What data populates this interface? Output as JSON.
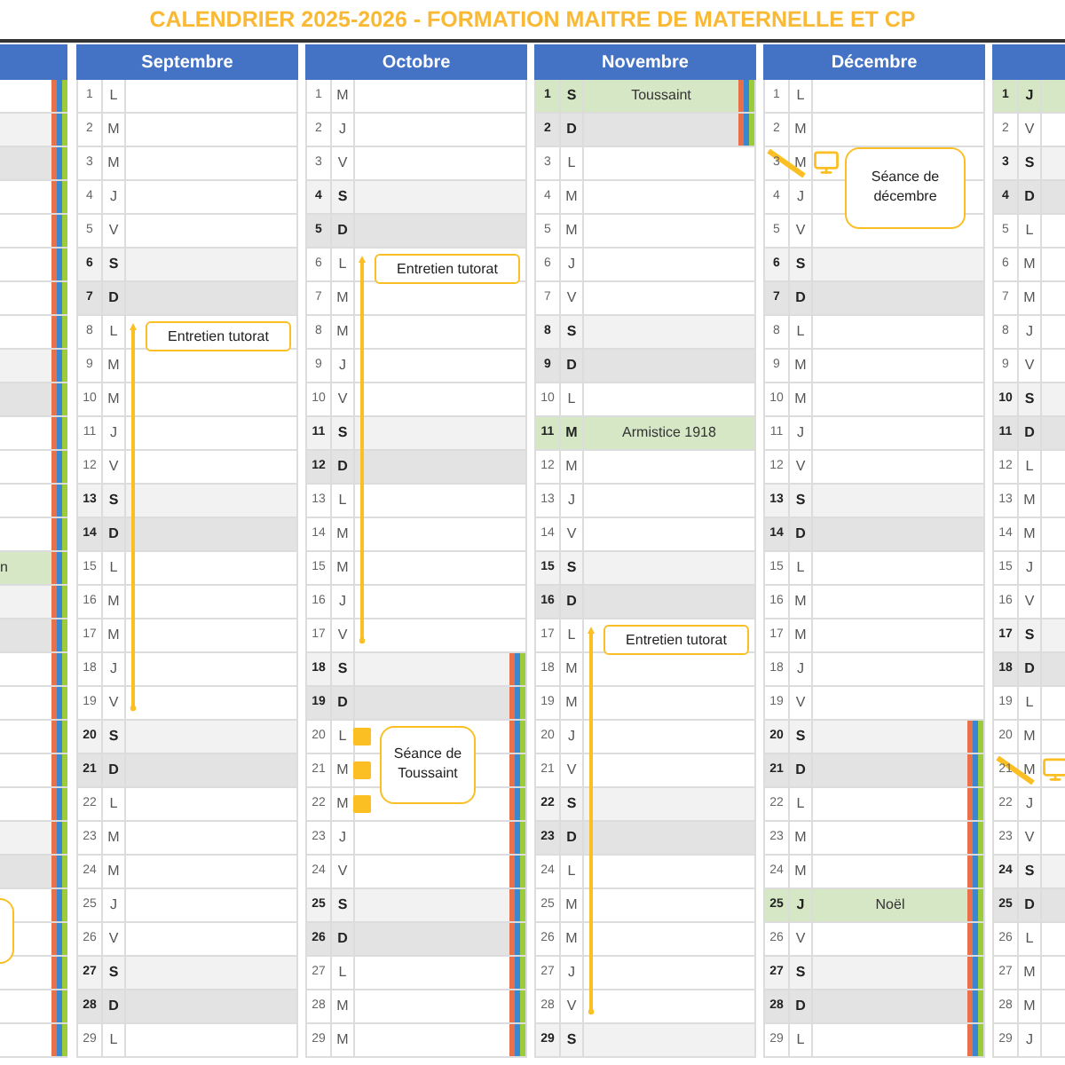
{
  "title": "CALENDRIER 2025-2026 - FORMATION MAITRE DE MATERNELLE ET CP",
  "months": [
    {
      "kind": "cut_left",
      "days": [
        {
          "kind": "wd",
          "vacation": true
        },
        {
          "kind": "sat",
          "vacation": true
        },
        {
          "kind": "sun",
          "vacation": true
        },
        {
          "kind": "wd",
          "vacation": true
        },
        {
          "kind": "wd",
          "vacation": true
        },
        {
          "kind": "wd",
          "vacation": true
        },
        {
          "kind": "wd",
          "vacation": true
        },
        {
          "kind": "wd",
          "vacation": true
        },
        {
          "kind": "sat",
          "vacation": true
        },
        {
          "kind": "sun",
          "vacation": true
        },
        {
          "kind": "wd",
          "vacation": true
        },
        {
          "kind": "wd",
          "vacation": true
        },
        {
          "kind": "wd",
          "vacation": true
        },
        {
          "kind": "wd",
          "vacation": true
        },
        {
          "kind": "hol",
          "label": "n",
          "vacation": true
        },
        {
          "kind": "sat",
          "vacation": true
        },
        {
          "kind": "sun",
          "vacation": true
        },
        {
          "kind": "wd",
          "vacation": true
        },
        {
          "kind": "wd",
          "vacation": true
        },
        {
          "kind": "wd",
          "vacation": true
        },
        {
          "kind": "wd",
          "vacation": true
        },
        {
          "kind": "wd",
          "vacation": true
        },
        {
          "kind": "sat",
          "vacation": true
        },
        {
          "kind": "sun",
          "vacation": true
        },
        {
          "kind": "wd",
          "vacation": true,
          "cut_callout": true
        },
        {
          "kind": "wd",
          "vacation": true
        },
        {
          "kind": "wd",
          "vacation": true
        },
        {
          "kind": "wd",
          "vacation": true
        },
        {
          "kind": "wd",
          "vacation": true
        }
      ]
    },
    {
      "kind": "full",
      "name": "Septembre",
      "days": [
        {
          "n": "1",
          "w": "L",
          "kind": "wd",
          "vacation": false
        },
        {
          "n": "2",
          "w": "M",
          "kind": "wd",
          "vacation": false
        },
        {
          "n": "3",
          "w": "M",
          "kind": "wd",
          "vacation": false
        },
        {
          "n": "4",
          "w": "J",
          "kind": "wd",
          "vacation": false
        },
        {
          "n": "5",
          "w": "V",
          "kind": "wd",
          "vacation": false
        },
        {
          "n": "6",
          "w": "S",
          "kind": "sat",
          "vacation": false
        },
        {
          "n": "7",
          "w": "D",
          "kind": "sun",
          "vacation": false
        },
        {
          "n": "8",
          "w": "L",
          "kind": "wd",
          "vacation": false,
          "note": "Entretien tutorat"
        },
        {
          "n": "9",
          "w": "M",
          "kind": "wd",
          "vacation": false
        },
        {
          "n": "10",
          "w": "M",
          "kind": "wd",
          "vacation": false
        },
        {
          "n": "11",
          "w": "J",
          "kind": "wd",
          "vacation": false
        },
        {
          "n": "12",
          "w": "V",
          "kind": "wd",
          "vacation": false
        },
        {
          "n": "13",
          "w": "S",
          "kind": "sat",
          "vacation": false
        },
        {
          "n": "14",
          "w": "D",
          "kind": "sun",
          "vacation": false
        },
        {
          "n": "15",
          "w": "L",
          "kind": "wd",
          "vacation": false
        },
        {
          "n": "16",
          "w": "M",
          "kind": "wd",
          "vacation": false
        },
        {
          "n": "17",
          "w": "M",
          "kind": "wd",
          "vacation": false
        },
        {
          "n": "18",
          "w": "J",
          "kind": "wd",
          "vacation": false
        },
        {
          "n": "19",
          "w": "V",
          "kind": "wd",
          "vacation": false,
          "arrow_end": true
        },
        {
          "n": "20",
          "w": "S",
          "kind": "sat",
          "vacation": false
        },
        {
          "n": "21",
          "w": "D",
          "kind": "sun",
          "vacation": false
        },
        {
          "n": "22",
          "w": "L",
          "kind": "wd",
          "vacation": false
        },
        {
          "n": "23",
          "w": "M",
          "kind": "wd",
          "vacation": false
        },
        {
          "n": "24",
          "w": "M",
          "kind": "wd",
          "vacation": false
        },
        {
          "n": "25",
          "w": "J",
          "kind": "wd",
          "vacation": false
        },
        {
          "n": "26",
          "w": "V",
          "kind": "wd",
          "vacation": false
        },
        {
          "n": "27",
          "w": "S",
          "kind": "sat",
          "vacation": false
        },
        {
          "n": "28",
          "w": "D",
          "kind": "sun",
          "vacation": false
        },
        {
          "n": "29",
          "w": "L",
          "kind": "wd",
          "vacation": false
        }
      ]
    },
    {
      "kind": "full",
      "name": "Octobre",
      "days": [
        {
          "n": "1",
          "w": "M",
          "kind": "wd",
          "vacation": false
        },
        {
          "n": "2",
          "w": "J",
          "kind": "wd",
          "vacation": false
        },
        {
          "n": "3",
          "w": "V",
          "kind": "wd",
          "vacation": false
        },
        {
          "n": "4",
          "w": "S",
          "kind": "sat",
          "vacation": false
        },
        {
          "n": "5",
          "w": "D",
          "kind": "sun",
          "vacation": false
        },
        {
          "n": "6",
          "w": "L",
          "kind": "wd",
          "vacation": false,
          "note": "Entretien tutorat"
        },
        {
          "n": "7",
          "w": "M",
          "kind": "wd",
          "vacation": false
        },
        {
          "n": "8",
          "w": "M",
          "kind": "wd",
          "vacation": false
        },
        {
          "n": "9",
          "w": "J",
          "kind": "wd",
          "vacation": false
        },
        {
          "n": "10",
          "w": "V",
          "kind": "wd",
          "vacation": false
        },
        {
          "n": "11",
          "w": "S",
          "kind": "sat",
          "vacation": false
        },
        {
          "n": "12",
          "w": "D",
          "kind": "sun",
          "vacation": false
        },
        {
          "n": "13",
          "w": "L",
          "kind": "wd",
          "vacation": false
        },
        {
          "n": "14",
          "w": "M",
          "kind": "wd",
          "vacation": false
        },
        {
          "n": "15",
          "w": "M",
          "kind": "wd",
          "vacation": false
        },
        {
          "n": "16",
          "w": "J",
          "kind": "wd",
          "vacation": false
        },
        {
          "n": "17",
          "w": "V",
          "kind": "wd",
          "vacation": false,
          "arrow_end": true
        },
        {
          "n": "18",
          "w": "S",
          "kind": "sat",
          "vacation": true
        },
        {
          "n": "19",
          "w": "D",
          "kind": "sun",
          "vacation": true
        },
        {
          "n": "20",
          "w": "L",
          "kind": "wd",
          "vacation": true,
          "marker": true,
          "callout": "Séance de Toussaint"
        },
        {
          "n": "21",
          "w": "M",
          "kind": "wd",
          "vacation": true,
          "marker": true
        },
        {
          "n": "22",
          "w": "M",
          "kind": "wd",
          "vacation": true,
          "marker": true
        },
        {
          "n": "23",
          "w": "J",
          "kind": "wd",
          "vacation": true
        },
        {
          "n": "24",
          "w": "V",
          "kind": "wd",
          "vacation": true
        },
        {
          "n": "25",
          "w": "S",
          "kind": "sat",
          "vacation": true
        },
        {
          "n": "26",
          "w": "D",
          "kind": "sun",
          "vacation": true
        },
        {
          "n": "27",
          "w": "L",
          "kind": "wd",
          "vacation": true
        },
        {
          "n": "28",
          "w": "M",
          "kind": "wd",
          "vacation": true
        },
        {
          "n": "29",
          "w": "M",
          "kind": "wd",
          "vacation": true
        }
      ]
    },
    {
      "kind": "full",
      "name": "Novembre",
      "days": [
        {
          "n": "1",
          "w": "S",
          "kind": "hol",
          "label": "Toussaint",
          "vacation": true
        },
        {
          "n": "2",
          "w": "D",
          "kind": "sun",
          "vacation": true
        },
        {
          "n": "3",
          "w": "L",
          "kind": "wd",
          "vacation": false
        },
        {
          "n": "4",
          "w": "M",
          "kind": "wd",
          "vacation": false
        },
        {
          "n": "5",
          "w": "M",
          "kind": "wd",
          "vacation": false
        },
        {
          "n": "6",
          "w": "J",
          "kind": "wd",
          "vacation": false
        },
        {
          "n": "7",
          "w": "V",
          "kind": "wd",
          "vacation": false
        },
        {
          "n": "8",
          "w": "S",
          "kind": "sat",
          "vacation": false
        },
        {
          "n": "9",
          "w": "D",
          "kind": "sun",
          "vacation": false
        },
        {
          "n": "10",
          "w": "L",
          "kind": "wd",
          "vacation": false
        },
        {
          "n": "11",
          "w": "M",
          "kind": "hol",
          "label": "Armistice 1918",
          "vacation": false
        },
        {
          "n": "12",
          "w": "M",
          "kind": "wd",
          "vacation": false
        },
        {
          "n": "13",
          "w": "J",
          "kind": "wd",
          "vacation": false
        },
        {
          "n": "14",
          "w": "V",
          "kind": "wd",
          "vacation": false
        },
        {
          "n": "15",
          "w": "S",
          "kind": "sat",
          "vacation": false
        },
        {
          "n": "16",
          "w": "D",
          "kind": "sun",
          "vacation": false
        },
        {
          "n": "17",
          "w": "L",
          "kind": "wd",
          "vacation": false,
          "note": "Entretien tutorat"
        },
        {
          "n": "18",
          "w": "M",
          "kind": "wd",
          "vacation": false
        },
        {
          "n": "19",
          "w": "M",
          "kind": "wd",
          "vacation": false
        },
        {
          "n": "20",
          "w": "J",
          "kind": "wd",
          "vacation": false
        },
        {
          "n": "21",
          "w": "V",
          "kind": "wd",
          "vacation": false
        },
        {
          "n": "22",
          "w": "S",
          "kind": "sat",
          "vacation": false
        },
        {
          "n": "23",
          "w": "D",
          "kind": "sun",
          "vacation": false
        },
        {
          "n": "24",
          "w": "L",
          "kind": "wd",
          "vacation": false
        },
        {
          "n": "25",
          "w": "M",
          "kind": "wd",
          "vacation": false
        },
        {
          "n": "26",
          "w": "M",
          "kind": "wd",
          "vacation": false
        },
        {
          "n": "27",
          "w": "J",
          "kind": "wd",
          "vacation": false
        },
        {
          "n": "28",
          "w": "V",
          "kind": "wd",
          "vacation": false,
          "arrow_end": true
        },
        {
          "n": "29",
          "w": "S",
          "kind": "sat",
          "vacation": false
        }
      ]
    },
    {
      "kind": "full",
      "name": "Décembre",
      "days": [
        {
          "n": "1",
          "w": "L",
          "kind": "wd",
          "vacation": false
        },
        {
          "n": "2",
          "w": "M",
          "kind": "wd",
          "vacation": false
        },
        {
          "n": "3",
          "w": "M",
          "kind": "wd",
          "vacation": false,
          "visio": true,
          "callout": "Séance de décembre"
        },
        {
          "n": "4",
          "w": "J",
          "kind": "wd",
          "vacation": false
        },
        {
          "n": "5",
          "w": "V",
          "kind": "wd",
          "vacation": false
        },
        {
          "n": "6",
          "w": "S",
          "kind": "sat",
          "vacation": false
        },
        {
          "n": "7",
          "w": "D",
          "kind": "sun",
          "vacation": false
        },
        {
          "n": "8",
          "w": "L",
          "kind": "wd",
          "vacation": false
        },
        {
          "n": "9",
          "w": "M",
          "kind": "wd",
          "vacation": false
        },
        {
          "n": "10",
          "w": "M",
          "kind": "wd",
          "vacation": false
        },
        {
          "n": "11",
          "w": "J",
          "kind": "wd",
          "vacation": false
        },
        {
          "n": "12",
          "w": "V",
          "kind": "wd",
          "vacation": false
        },
        {
          "n": "13",
          "w": "S",
          "kind": "sat",
          "vacation": false
        },
        {
          "n": "14",
          "w": "D",
          "kind": "sun",
          "vacation": false
        },
        {
          "n": "15",
          "w": "L",
          "kind": "wd",
          "vacation": false
        },
        {
          "n": "16",
          "w": "M",
          "kind": "wd",
          "vacation": false
        },
        {
          "n": "17",
          "w": "M",
          "kind": "wd",
          "vacation": false
        },
        {
          "n": "18",
          "w": "J",
          "kind": "wd",
          "vacation": false
        },
        {
          "n": "19",
          "w": "V",
          "kind": "wd",
          "vacation": false
        },
        {
          "n": "20",
          "w": "S",
          "kind": "sat",
          "vacation": true
        },
        {
          "n": "21",
          "w": "D",
          "kind": "sun",
          "vacation": true
        },
        {
          "n": "22",
          "w": "L",
          "kind": "wd",
          "vacation": true
        },
        {
          "n": "23",
          "w": "M",
          "kind": "wd",
          "vacation": true
        },
        {
          "n": "24",
          "w": "M",
          "kind": "wd",
          "vacation": true
        },
        {
          "n": "25",
          "w": "J",
          "kind": "hol",
          "label": "Noël",
          "vacation": true
        },
        {
          "n": "26",
          "w": "V",
          "kind": "wd",
          "vacation": true
        },
        {
          "n": "27",
          "w": "S",
          "kind": "sat",
          "vacation": true
        },
        {
          "n": "28",
          "w": "D",
          "kind": "sun",
          "vacation": true
        },
        {
          "n": "29",
          "w": "L",
          "kind": "wd",
          "vacation": true
        }
      ]
    },
    {
      "kind": "full",
      "days": [
        {
          "n": "1",
          "w": "J",
          "kind": "hol"
        },
        {
          "n": "2",
          "w": "V",
          "kind": "wd"
        },
        {
          "n": "3",
          "w": "S",
          "kind": "sat"
        },
        {
          "n": "4",
          "w": "D",
          "kind": "sun"
        },
        {
          "n": "5",
          "w": "L",
          "kind": "wd"
        },
        {
          "n": "6",
          "w": "M",
          "kind": "wd"
        },
        {
          "n": "7",
          "w": "M",
          "kind": "wd"
        },
        {
          "n": "8",
          "w": "J",
          "kind": "wd"
        },
        {
          "n": "9",
          "w": "V",
          "kind": "wd"
        },
        {
          "n": "10",
          "w": "S",
          "kind": "sat"
        },
        {
          "n": "11",
          "w": "D",
          "kind": "sun"
        },
        {
          "n": "12",
          "w": "L",
          "kind": "wd"
        },
        {
          "n": "13",
          "w": "M",
          "kind": "wd"
        },
        {
          "n": "14",
          "w": "M",
          "kind": "wd"
        },
        {
          "n": "15",
          "w": "J",
          "kind": "wd"
        },
        {
          "n": "16",
          "w": "V",
          "kind": "wd"
        },
        {
          "n": "17",
          "w": "S",
          "kind": "sat"
        },
        {
          "n": "18",
          "w": "D",
          "kind": "sun"
        },
        {
          "n": "19",
          "w": "L",
          "kind": "wd"
        },
        {
          "n": "20",
          "w": "M",
          "kind": "wd"
        },
        {
          "n": "21",
          "w": "M",
          "kind": "wd",
          "visio": true
        },
        {
          "n": "22",
          "w": "J",
          "kind": "wd"
        },
        {
          "n": "23",
          "w": "V",
          "kind": "wd"
        },
        {
          "n": "24",
          "w": "S",
          "kind": "sat"
        },
        {
          "n": "25",
          "w": "D",
          "kind": "sun"
        },
        {
          "n": "26",
          "w": "L",
          "kind": "wd"
        },
        {
          "n": "27",
          "w": "M",
          "kind": "wd"
        },
        {
          "n": "28",
          "w": "M",
          "kind": "wd"
        },
        {
          "n": "29",
          "w": "J",
          "kind": "wd"
        }
      ]
    }
  ]
}
